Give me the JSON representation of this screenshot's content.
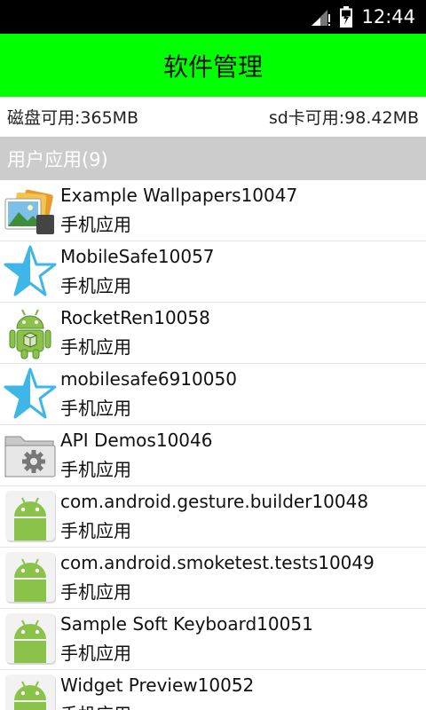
{
  "status_bar": {
    "time": "12:44"
  },
  "title_bar": {
    "title": "软件管理"
  },
  "storage": {
    "disk": "磁盘可用:365MB",
    "sd": "sd卡可用:98.42MB"
  },
  "section": {
    "label": "用户应用(9)"
  },
  "apps": [
    {
      "name": "Example Wallpapers10047",
      "type": "手机应用",
      "icon": "wallpaper-icon"
    },
    {
      "name": "MobileSafe10057",
      "type": "手机应用",
      "icon": "star-icon"
    },
    {
      "name": "RocketRen10058",
      "type": "手机应用",
      "icon": "android-robot-icon"
    },
    {
      "name": "mobilesafe6910050",
      "type": "手机应用",
      "icon": "star-icon"
    },
    {
      "name": "API Demos10046",
      "type": "手机应用",
      "icon": "folder-gear-icon"
    },
    {
      "name": "com.android.gesture.builder10048",
      "type": "手机应用",
      "icon": "android-icon"
    },
    {
      "name": "com.android.smoketest.tests10049",
      "type": "手机应用",
      "icon": "android-icon"
    },
    {
      "name": "Sample Soft Keyboard10051",
      "type": "手机应用",
      "icon": "android-icon"
    },
    {
      "name": "Widget Preview10052",
      "type": "手机应用",
      "icon": "android-icon"
    }
  ]
}
